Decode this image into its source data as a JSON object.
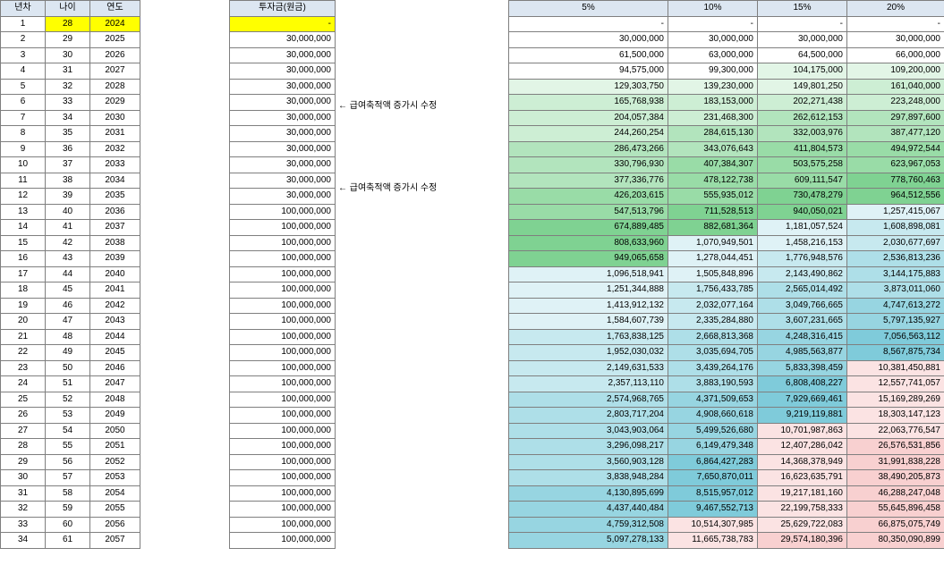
{
  "left_headers": [
    "년차",
    "나이",
    "연도"
  ],
  "invest_header": "투자금(원금)",
  "rate_headers": [
    "5%",
    "10%",
    "15%",
    "20%"
  ],
  "notes": [
    {
      "row": 5,
      "text": "← 급여축적액 증가시 수정"
    },
    {
      "row": 10,
      "text": "← 급여축적액 증가시 수정"
    }
  ],
  "rows": [
    {
      "n": "1",
      "age": "28",
      "year": "2024",
      "invest": "-",
      "v": [
        "-",
        "-",
        "-",
        "-"
      ]
    },
    {
      "n": "2",
      "age": "29",
      "year": "2025",
      "invest": "30,000,000",
      "v": [
        "30,000,000",
        "30,000,000",
        "30,000,000",
        "30,000,000"
      ]
    },
    {
      "n": "3",
      "age": "30",
      "year": "2026",
      "invest": "30,000,000",
      "v": [
        "61,500,000",
        "63,000,000",
        "64,500,000",
        "66,000,000"
      ]
    },
    {
      "n": "4",
      "age": "31",
      "year": "2027",
      "invest": "30,000,000",
      "v": [
        "94,575,000",
        "99,300,000",
        "104,175,000",
        "109,200,000"
      ]
    },
    {
      "n": "5",
      "age": "32",
      "year": "2028",
      "invest": "30,000,000",
      "v": [
        "129,303,750",
        "139,230,000",
        "149,801,250",
        "161,040,000"
      ]
    },
    {
      "n": "6",
      "age": "33",
      "year": "2029",
      "invest": "30,000,000",
      "v": [
        "165,768,938",
        "183,153,000",
        "202,271,438",
        "223,248,000"
      ]
    },
    {
      "n": "7",
      "age": "34",
      "year": "2030",
      "invest": "30,000,000",
      "v": [
        "204,057,384",
        "231,468,300",
        "262,612,153",
        "297,897,600"
      ]
    },
    {
      "n": "8",
      "age": "35",
      "year": "2031",
      "invest": "30,000,000",
      "v": [
        "244,260,254",
        "284,615,130",
        "332,003,976",
        "387,477,120"
      ]
    },
    {
      "n": "9",
      "age": "36",
      "year": "2032",
      "invest": "30,000,000",
      "v": [
        "286,473,266",
        "343,076,643",
        "411,804,573",
        "494,972,544"
      ]
    },
    {
      "n": "10",
      "age": "37",
      "year": "2033",
      "invest": "30,000,000",
      "v": [
        "330,796,930",
        "407,384,307",
        "503,575,258",
        "623,967,053"
      ]
    },
    {
      "n": "11",
      "age": "38",
      "year": "2034",
      "invest": "30,000,000",
      "v": [
        "377,336,776",
        "478,122,738",
        "609,111,547",
        "778,760,463"
      ]
    },
    {
      "n": "12",
      "age": "39",
      "year": "2035",
      "invest": "30,000,000",
      "v": [
        "426,203,615",
        "555,935,012",
        "730,478,279",
        "964,512,556"
      ]
    },
    {
      "n": "13",
      "age": "40",
      "year": "2036",
      "invest": "100,000,000",
      "v": [
        "547,513,796",
        "711,528,513",
        "940,050,021",
        "1,257,415,067"
      ]
    },
    {
      "n": "14",
      "age": "41",
      "year": "2037",
      "invest": "100,000,000",
      "v": [
        "674,889,485",
        "882,681,364",
        "1,181,057,524",
        "1,608,898,081"
      ]
    },
    {
      "n": "15",
      "age": "42",
      "year": "2038",
      "invest": "100,000,000",
      "v": [
        "808,633,960",
        "1,070,949,501",
        "1,458,216,153",
        "2,030,677,697"
      ]
    },
    {
      "n": "16",
      "age": "43",
      "year": "2039",
      "invest": "100,000,000",
      "v": [
        "949,065,658",
        "1,278,044,451",
        "1,776,948,576",
        "2,536,813,236"
      ]
    },
    {
      "n": "17",
      "age": "44",
      "year": "2040",
      "invest": "100,000,000",
      "v": [
        "1,096,518,941",
        "1,505,848,896",
        "2,143,490,862",
        "3,144,175,883"
      ]
    },
    {
      "n": "18",
      "age": "45",
      "year": "2041",
      "invest": "100,000,000",
      "v": [
        "1,251,344,888",
        "1,756,433,785",
        "2,565,014,492",
        "3,873,011,060"
      ]
    },
    {
      "n": "19",
      "age": "46",
      "year": "2042",
      "invest": "100,000,000",
      "v": [
        "1,413,912,132",
        "2,032,077,164",
        "3,049,766,665",
        "4,747,613,272"
      ]
    },
    {
      "n": "20",
      "age": "47",
      "year": "2043",
      "invest": "100,000,000",
      "v": [
        "1,584,607,739",
        "2,335,284,880",
        "3,607,231,665",
        "5,797,135,927"
      ]
    },
    {
      "n": "21",
      "age": "48",
      "year": "2044",
      "invest": "100,000,000",
      "v": [
        "1,763,838,125",
        "2,668,813,368",
        "4,248,316,415",
        "7,056,563,112"
      ]
    },
    {
      "n": "22",
      "age": "49",
      "year": "2045",
      "invest": "100,000,000",
      "v": [
        "1,952,030,032",
        "3,035,694,705",
        "4,985,563,877",
        "8,567,875,734"
      ]
    },
    {
      "n": "23",
      "age": "50",
      "year": "2046",
      "invest": "100,000,000",
      "v": [
        "2,149,631,533",
        "3,439,264,176",
        "5,833,398,459",
        "10,381,450,881"
      ]
    },
    {
      "n": "24",
      "age": "51",
      "year": "2047",
      "invest": "100,000,000",
      "v": [
        "2,357,113,110",
        "3,883,190,593",
        "6,808,408,227",
        "12,557,741,057"
      ]
    },
    {
      "n": "25",
      "age": "52",
      "year": "2048",
      "invest": "100,000,000",
      "v": [
        "2,574,968,765",
        "4,371,509,653",
        "7,929,669,461",
        "15,169,289,269"
      ]
    },
    {
      "n": "26",
      "age": "53",
      "year": "2049",
      "invest": "100,000,000",
      "v": [
        "2,803,717,204",
        "4,908,660,618",
        "9,219,119,881",
        "18,303,147,123"
      ]
    },
    {
      "n": "27",
      "age": "54",
      "year": "2050",
      "invest": "100,000,000",
      "v": [
        "3,043,903,064",
        "5,499,526,680",
        "10,701,987,863",
        "22,063,776,547"
      ]
    },
    {
      "n": "28",
      "age": "55",
      "year": "2051",
      "invest": "100,000,000",
      "v": [
        "3,296,098,217",
        "6,149,479,348",
        "12,407,286,042",
        "26,576,531,856"
      ]
    },
    {
      "n": "29",
      "age": "56",
      "year": "2052",
      "invest": "100,000,000",
      "v": [
        "3,560,903,128",
        "6,864,427,283",
        "14,368,378,949",
        "31,991,838,228"
      ]
    },
    {
      "n": "30",
      "age": "57",
      "year": "2053",
      "invest": "100,000,000",
      "v": [
        "3,838,948,284",
        "7,650,870,011",
        "16,623,635,791",
        "38,490,205,873"
      ]
    },
    {
      "n": "31",
      "age": "58",
      "year": "2054",
      "invest": "100,000,000",
      "v": [
        "4,130,895,699",
        "8,515,957,012",
        "19,217,181,160",
        "46,288,247,048"
      ]
    },
    {
      "n": "32",
      "age": "59",
      "year": "2055",
      "invest": "100,000,000",
      "v": [
        "4,437,440,484",
        "9,467,552,713",
        "22,199,758,333",
        "55,645,896,458"
      ]
    },
    {
      "n": "33",
      "age": "60",
      "year": "2056",
      "invest": "100,000,000",
      "v": [
        "4,759,312,508",
        "10,514,307,985",
        "25,629,722,083",
        "66,875,075,749"
      ]
    },
    {
      "n": "34",
      "age": "61",
      "year": "2057",
      "invest": "100,000,000",
      "v": [
        "5,097,278,133",
        "11,665,738,783",
        "29,574,180,396",
        "80,350,090,899"
      ]
    }
  ],
  "colors": {
    "header": "#dce6f1",
    "highlight": "#ffff00",
    "white": "#ffffff",
    "greens": [
      "#e2f5e6",
      "#cdeed4",
      "#b2e4bd",
      "#99dca7",
      "#7fd292"
    ],
    "blues": [
      "#dff2f6",
      "#c7e9ef",
      "#aedfe8",
      "#97d5e1",
      "#7fcbda"
    ],
    "pinks": [
      "#fbe3e3",
      "#f8d0d0"
    ]
  }
}
